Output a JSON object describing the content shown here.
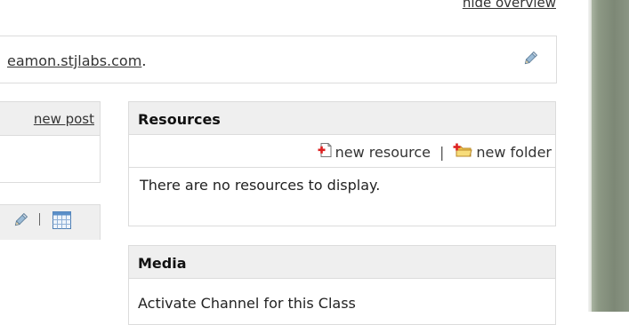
{
  "top": {
    "hide_overview": "hide overview"
  },
  "url_box": {
    "link_text": "eamon.stjlabs.com",
    "suffix": "."
  },
  "blog": {
    "new_post": "new post"
  },
  "resources": {
    "title": "Resources",
    "new_resource": "new resource",
    "separator": "|",
    "new_folder": "new folder",
    "empty_message": "There are no resources to display."
  },
  "media": {
    "title": "Media",
    "activate_text": "Activate Channel for this Class"
  },
  "colors": {
    "header_bg": "#efefef",
    "border": "#dcdcdc",
    "side_strip": "#7d8876"
  },
  "icons": [
    "pencil-icon",
    "calendar-icon",
    "new-resource-icon",
    "new-folder-icon"
  ]
}
